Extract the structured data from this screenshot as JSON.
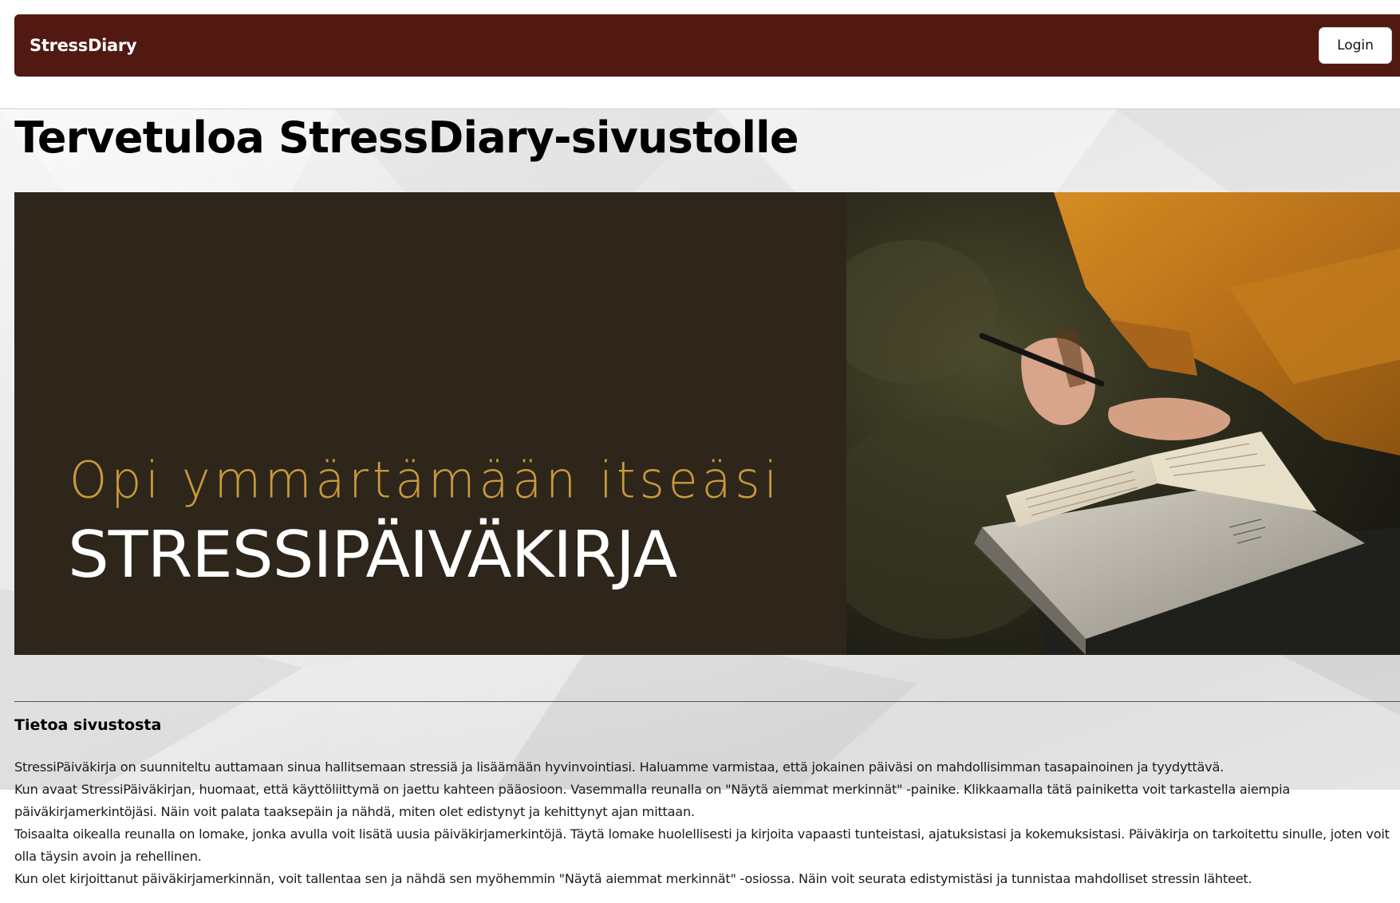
{
  "navbar": {
    "brand": "StressDiary",
    "login_label": "Login"
  },
  "page_title": "Tervetuloa StressDiary-sivustolle",
  "hero": {
    "tagline": "Opi ymmärtämään itseäsi",
    "heading": "STRESSIPÄIVÄKIRJA",
    "image": "person-writing-in-journal"
  },
  "about": {
    "heading": "Tietoa sivustosta",
    "paragraphs": [
      "StressiPäiväkirja on suunniteltu auttamaan sinua hallitsemaan stressiä ja lisäämään hyvinvointiasi. Haluamme varmistaa, että jokainen päiväsi on mahdollisimman tasapainoinen ja tyydyttävä.",
      "Kun avaat StressiPäiväkirjan, huomaat, että käyttöliittymä on jaettu kahteen pääosioon. Vasemmalla reunalla on \"Näytä aiemmat merkinnät\" -painike. Klikkaamalla tätä painiketta voit tarkastella aiempia päiväkirjamerkintöjäsi. Näin voit palata taaksepäin ja nähdä, miten olet edistynyt ja kehittynyt ajan mittaan.",
      "Toisaalta oikealla reunalla on lomake, jonka avulla voit lisätä uusia päiväkirjamerkintöjä. Täytä lomake huolellisesti ja kirjoita vapaasti tunteistasi, ajatuksistasi ja kokemuksistasi. Päiväkirja on tarkoitettu sinulle, joten voit olla täysin avoin ja rehellinen.",
      "Kun olet kirjoittanut päiväkirjamerkinnän, voit tallentaa sen ja nähdä sen myöhemmin \"Näytä aiemmat merkinnät\" -osiossa. Näin voit seurata edistymistäsi ja tunnistaa mahdolliset stressin lähteet."
    ]
  },
  "colors": {
    "navbar_bg": "#521812",
    "hero_dark": "#2e261b",
    "hero_gold": "#c99a3a",
    "jacket_orange": "#c9821c"
  }
}
